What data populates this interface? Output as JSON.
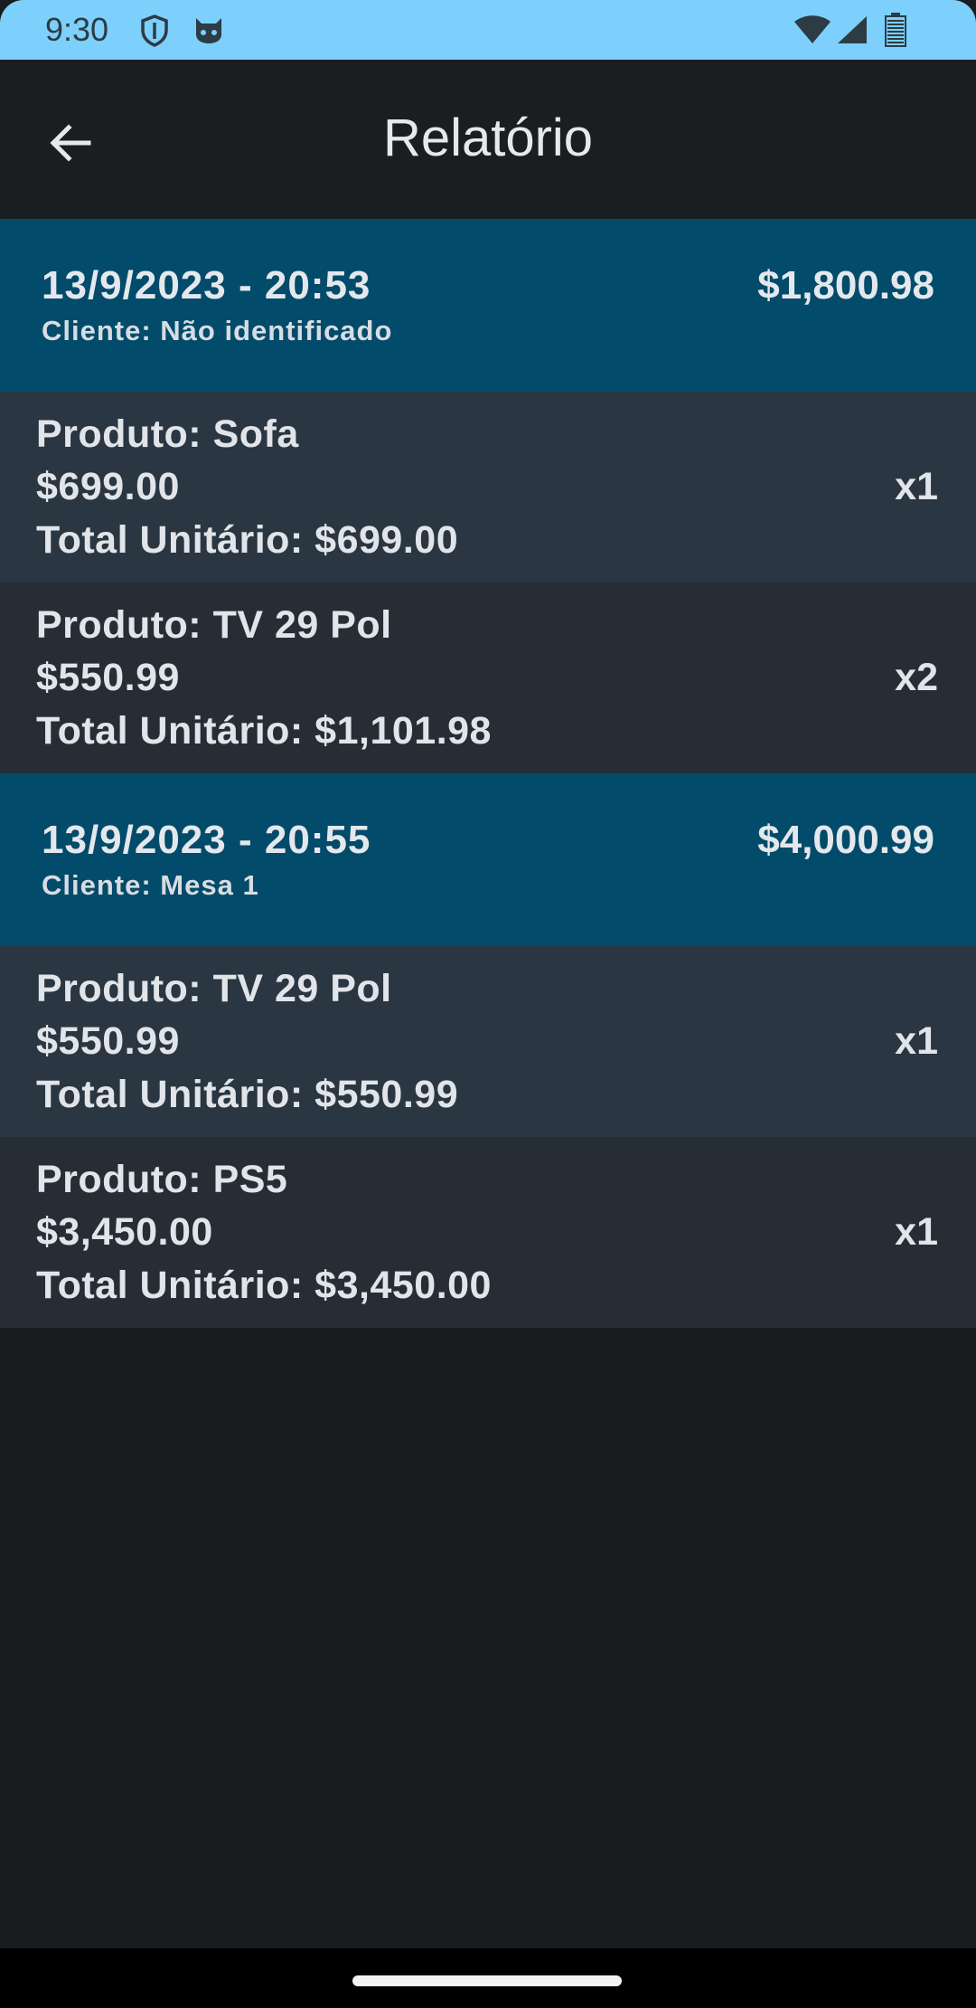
{
  "status_bar": {
    "time": "9:30",
    "icons": [
      "shield-icon",
      "cat-icon",
      "wifi-icon",
      "signal-icon",
      "battery-icon"
    ]
  },
  "app_bar": {
    "title": "Relatório",
    "back_icon": "arrow-back-icon"
  },
  "sales": [
    {
      "date": "13/9/2023 - 20:53",
      "total": "$1,800.98",
      "client": "Cliente: Não identificado",
      "items": [
        {
          "name": "Produto: Sofa",
          "price": "$699.00",
          "total": "Total Unitário: $699.00",
          "qty": "x1"
        },
        {
          "name": "Produto: TV 29 Pol",
          "price": "$550.99",
          "total": "Total Unitário: $1,101.98",
          "qty": "x2"
        }
      ]
    },
    {
      "date": "13/9/2023 - 20:55",
      "total": "$4,000.99",
      "client": "Cliente: Mesa 1",
      "items": [
        {
          "name": "Produto: TV 29 Pol",
          "price": "$550.99",
          "total": "Total Unitário: $550.99",
          "qty": "x1"
        },
        {
          "name": "Produto: PS5",
          "price": "$3,450.00",
          "total": "Total Unitário: $3,450.00",
          "qty": "x1"
        }
      ]
    }
  ],
  "colors": {
    "status_bar": "#7cd0fb",
    "background": "#191c1f",
    "sale_header": "#034b6b",
    "row_light": "#2a3641",
    "row_dark": "#262d35"
  }
}
